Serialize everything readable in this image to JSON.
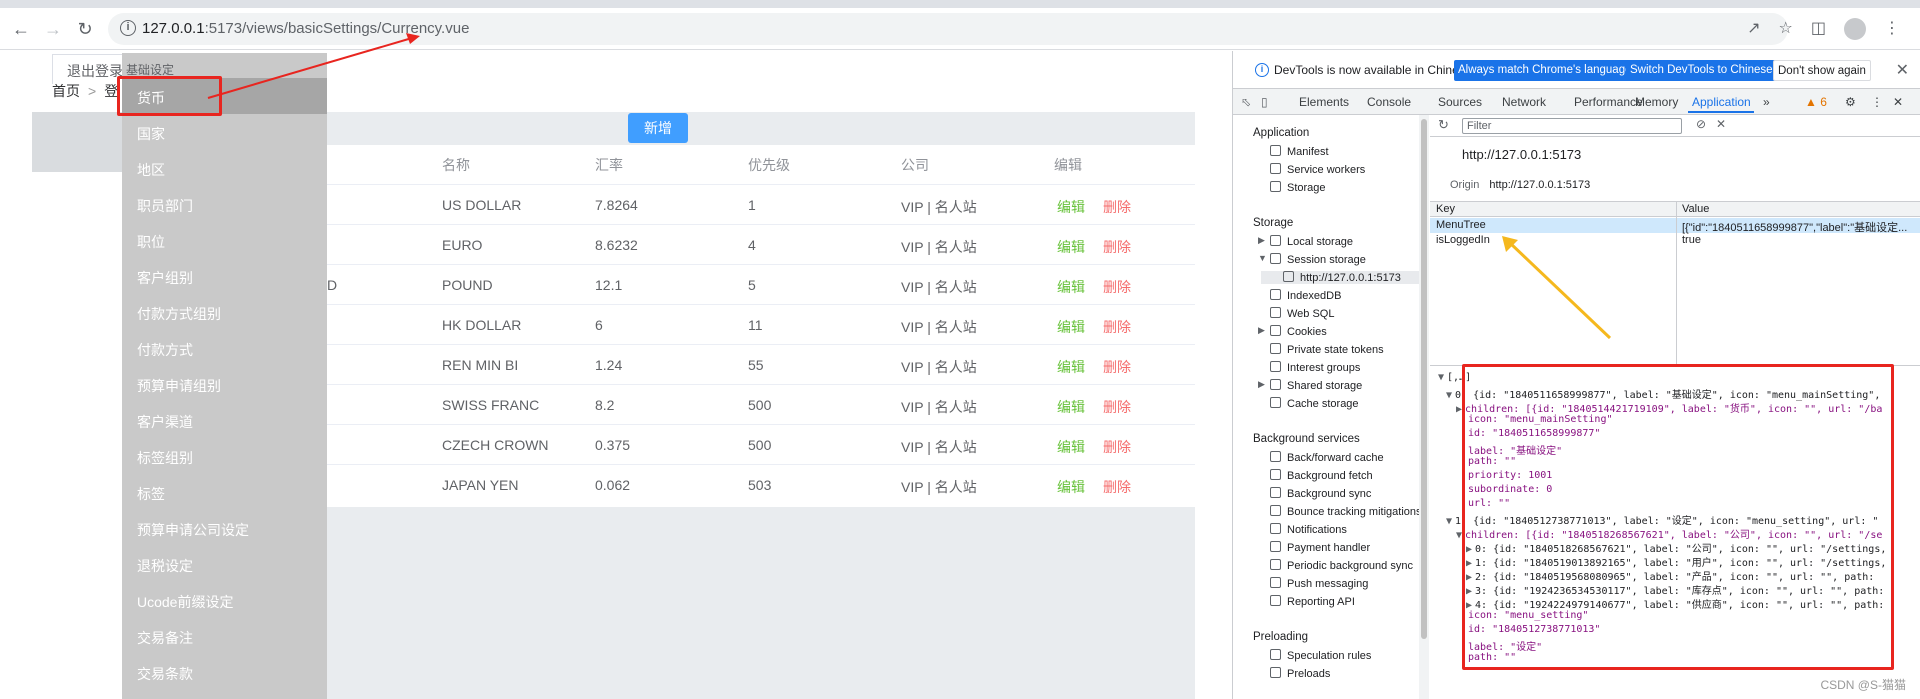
{
  "browser": {
    "url_host": "127.0.0.1",
    "url_path": ":5173/views/basicSettings/Currency.vue"
  },
  "app": {
    "logout_label": "退出登录",
    "breadcrumb": [
      "首页",
      ">",
      "登"
    ],
    "add_button": "新增",
    "table": {
      "headers": [
        "名称",
        "汇率",
        "优先级",
        "公司",
        "编辑"
      ],
      "rows": [
        {
          "code": "",
          "name": "US DOLLAR",
          "rate": "7.8264",
          "priority": "1",
          "company": "VIP | 名人站"
        },
        {
          "code": "",
          "name": "EURO",
          "rate": "8.6232",
          "priority": "4",
          "company": "VIP | 名人站"
        },
        {
          "code": "D",
          "name": "POUND",
          "rate": "12.1",
          "priority": "5",
          "company": "VIP | 名人站"
        },
        {
          "code": "",
          "name": "HK DOLLAR",
          "rate": "6",
          "priority": "11",
          "company": "VIP | 名人站"
        },
        {
          "code": "",
          "name": "REN MIN BI",
          "rate": "1.24",
          "priority": "55",
          "company": "VIP | 名人站"
        },
        {
          "code": "",
          "name": "SWISS FRANC",
          "rate": "8.2",
          "priority": "500",
          "company": "VIP | 名人站"
        },
        {
          "code": "",
          "name": "CZECH CROWN",
          "rate": "0.375",
          "priority": "500",
          "company": "VIP | 名人站"
        },
        {
          "code": "",
          "name": "JAPAN YEN",
          "rate": "0.062",
          "priority": "503",
          "company": "VIP | 名人站"
        }
      ],
      "edit_label": "编辑",
      "delete_label": "删除"
    }
  },
  "menu": {
    "header": "基础设定",
    "items": [
      "货币",
      "国家",
      "地区",
      "职员部门",
      "职位",
      "客户组别",
      "付款方式组别",
      "付款方式",
      "预算申请组别",
      "客户渠道",
      "标签组别",
      "标签",
      "预算申请公司设定",
      "退税设定",
      "Ucode前缀设定",
      "交易备注",
      "交易条款"
    ]
  },
  "devtools": {
    "banner": {
      "message": "DevTools is now available in Chinese!",
      "btn_match": "Always match Chrome's language",
      "btn_switch": "Switch DevTools to Chinese",
      "btn_dismiss": "Don't show again"
    },
    "tabs": [
      "Elements",
      "Console",
      "Sources",
      "Network",
      "Performance",
      "Memory",
      "Application"
    ],
    "warning_count": "6",
    "filter_placeholder": "Filter",
    "sidebar": {
      "application_title": "Application",
      "application_items": [
        "Manifest",
        "Service workers",
        "Storage"
      ],
      "storage_title": "Storage",
      "storage_items": [
        "Local storage",
        "Session storage",
        "http://127.0.0.1:5173",
        "IndexedDB",
        "Web SQL",
        "Cookies",
        "Private state tokens",
        "Interest groups",
        "Shared storage",
        "Cache storage"
      ],
      "background_title": "Background services",
      "background_items": [
        "Back/forward cache",
        "Background fetch",
        "Background sync",
        "Bounce tracking mitigations",
        "Notifications",
        "Payment handler",
        "Periodic background sync",
        "Push messaging",
        "Reporting API"
      ],
      "preloading_title": "Preloading",
      "preloading_items": [
        "Speculation rules",
        "Preloads"
      ]
    },
    "origin_title": "http://127.0.0.1:5173",
    "origin_label": "Origin",
    "origin_value": "http://127.0.0.1:5173",
    "kv_headers": [
      "Key",
      "Value"
    ],
    "kv_rows": [
      {
        "key": "MenuTree",
        "value": "[{\"id\":\"1840511658999877\",\"label\":\"基础设定..."
      },
      {
        "key": "isLoggedIn",
        "value": "true"
      }
    ],
    "json_lines": [
      "[,…]",
      "0: {id: \"1840511658999877\", label: \"基础设定\", icon: \"menu_mainSetting\",",
      "children: [{id: \"1840514421719109\", label: \"货币\", icon: \"\", url: \"/ba",
      "icon: \"menu_mainSetting\"",
      "id: \"1840511658999877\"",
      "label: \"基础设定\"",
      "path: \"\"",
      "priority: 1001",
      "subordinate: 0",
      "url: \"\"",
      "1: {id: \"1840512738771013\", label: \"设定\", icon: \"menu_setting\", url: \"",
      "children: [{id: \"1840518268567621\", label: \"公司\", icon: \"\", url: \"/se",
      "0: {id: \"1840518268567621\", label: \"公司\", icon: \"\", url: \"/settings,",
      "1: {id: \"1840519013892165\", label: \"用户\", icon: \"\", url: \"/settings,",
      "2: {id: \"1840519568080965\", label: \"产品\", icon: \"\", url: \"\", path:",
      "3: {id: \"1924236534530117\", label: \"库存点\", icon: \"\", url: \"\", path:",
      "4: {id: \"1924224979140677\", label: \"供应商\", icon: \"\", url: \"\", path:",
      "icon: \"menu_setting\"",
      "id: \"1840512738771013\"",
      "label: \"设定\"",
      "path: \"\""
    ]
  },
  "watermark": "CSDN @S-猫猫"
}
